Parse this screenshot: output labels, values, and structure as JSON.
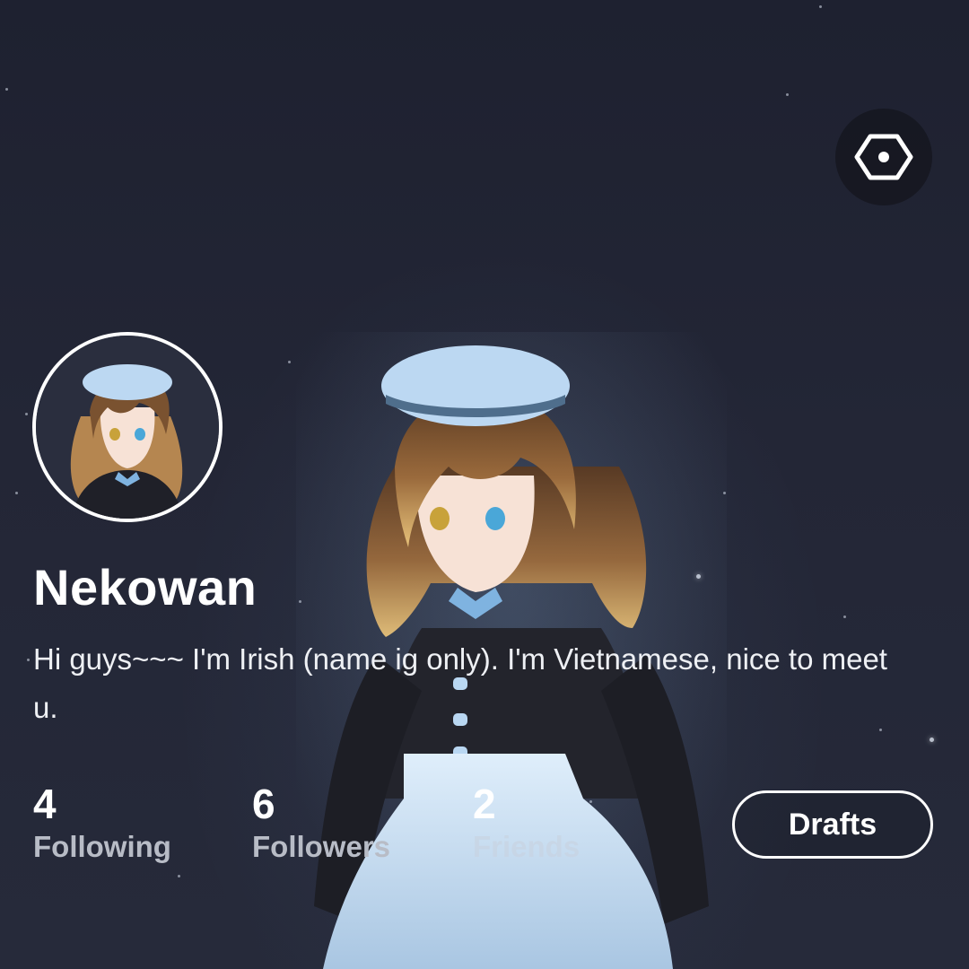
{
  "profile": {
    "username": "Nekowan",
    "bio": "Hi guys~~~ I'm Irish (name ig only). I'm Vietnamese, nice to meet u."
  },
  "stats": {
    "following": {
      "value": "4",
      "label": "Following"
    },
    "followers": {
      "value": "6",
      "label": "Followers"
    },
    "friends": {
      "value": "2",
      "label": "Friends"
    }
  },
  "actions": {
    "drafts_label": "Drafts"
  },
  "icons": {
    "settings": "hexagon-settings-icon",
    "avatar": "profile-avatar"
  },
  "colors": {
    "background": "#1f2230",
    "text_primary": "#ffffff",
    "text_secondary": "#b8bcc6",
    "accent_beret": "#bcd8f2"
  }
}
